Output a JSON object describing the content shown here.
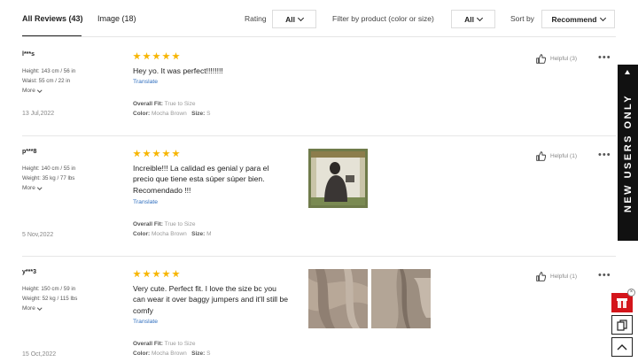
{
  "tabs": {
    "all_reviews": "All Reviews (43)",
    "image": "Image (18)"
  },
  "filters": {
    "rating_label": "Rating",
    "rating_value": "All",
    "product_label": "Filter by product  (color or size)",
    "product_value": "All",
    "sort_label": "Sort by",
    "sort_value": "Recommend"
  },
  "reviews": [
    {
      "user": "l***s",
      "stat1": "Height: 143 cm / 56 in",
      "stat2": "Waist: 55 cm / 22 in",
      "more": "More",
      "date": "13 Jul,2022",
      "text": "Hey yo. It was perfect!!!!!!!!",
      "translate": "Translate",
      "fit_label": "Overall Fit:",
      "fit_value": "True to Size",
      "color_label": "Color:",
      "color_value": "Mocha Brown",
      "size_label": "Size:",
      "size_value": "S",
      "helpful": "Helpful (3)",
      "stars": 5
    },
    {
      "user": "p***8",
      "stat1": "Height: 140 cm / 55 in",
      "stat2": "Weight: 35 kg / 77 lbs",
      "more": "More",
      "date": "5 Nov,2022",
      "text": "Increible!!! La calidad es genial y para el precio que tiene esta súper súper bien. Recomendado !!!",
      "translate": "Translate",
      "fit_label": "Overall Fit:",
      "fit_value": "True to Size",
      "color_label": "Color:",
      "color_value": "Mocha Brown",
      "size_label": "Size:",
      "size_value": "M",
      "helpful": "Helpful (1)",
      "stars": 5
    },
    {
      "user": "y***3",
      "stat1": "Height: 150 cm / 59 in",
      "stat2": "Weight: 52 kg / 115 lbs",
      "more": "More",
      "date": "15 Oct,2022",
      "text": "Very cute. Perfect fit. I love the size bc you can wear it over baggy jumpers and it'll still be comfy",
      "translate": "Translate",
      "fit_label": "Overall Fit:",
      "fit_value": "True to Size",
      "color_label": "Color:",
      "color_value": "Mocha Brown",
      "size_label": "Size:",
      "size_value": "S",
      "helpful": "Helpful (1)",
      "stars": 5
    }
  ],
  "banner": {
    "text": "NEW USERS ONLY"
  },
  "colors": {
    "star": "#f7b500",
    "link": "#2f6fbf",
    "banner_bg": "#111111",
    "promo": "#d4151b"
  }
}
